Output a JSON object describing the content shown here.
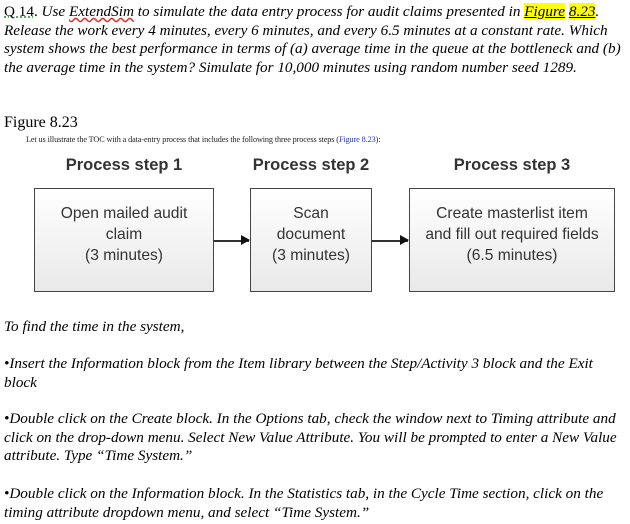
{
  "question": {
    "number": "Q 14",
    "sep": ". ",
    "text_1": "Use ",
    "software": "ExtendSim",
    "text_2": " to simulate the data entry process for audit claims presented in ",
    "figure_ref_a": "Figure",
    "figure_ref_b": "8.23",
    "text_3": ". Release the work every 4 minutes, every 6 minutes, and every 6.5 minutes at a constant rate. Which system shows the best performance in terms of (a) average time in the queue at the bottleneck and (b) the average time in the system? Simulate for 10,000 minutes using random number seed 1289."
  },
  "figure": {
    "title": "Figure 8.23",
    "caption_text": "Let us illustrate the TOC with a data-entry process that includes the following three process steps (",
    "caption_link": "Figure 8.23",
    "caption_end": "):",
    "steps": [
      {
        "heading": "Process step 1",
        "line1": "Open mailed audit",
        "line2": "claim",
        "line3": "(3 minutes)"
      },
      {
        "heading": "Process step 2",
        "line1": "Scan",
        "line2": "document",
        "line3": "(3 minutes)"
      },
      {
        "heading": "Process step 3",
        "line1": "Create masterlist item",
        "line2": "and fill out required fields",
        "line3": "(6.5 minutes)"
      }
    ]
  },
  "instructions": {
    "intro": "To find the time in the system,",
    "bullets": [
      "•Insert the Information block from the Item library between the Step/Activity  3 block and the Exit block",
      "•Double click on the Create block. In the Options tab, check the window next to Timing attribute and click on the drop-down menu. Select New Value Attribute.  You will be prompted to enter a New Value attribute. Type “Time System.”",
      "•Double click on the Information block. In the Statistics tab, in the Cycle Time section,  click on the timing attribute  dropdown menu, and select  “Time System.”"
    ]
  }
}
